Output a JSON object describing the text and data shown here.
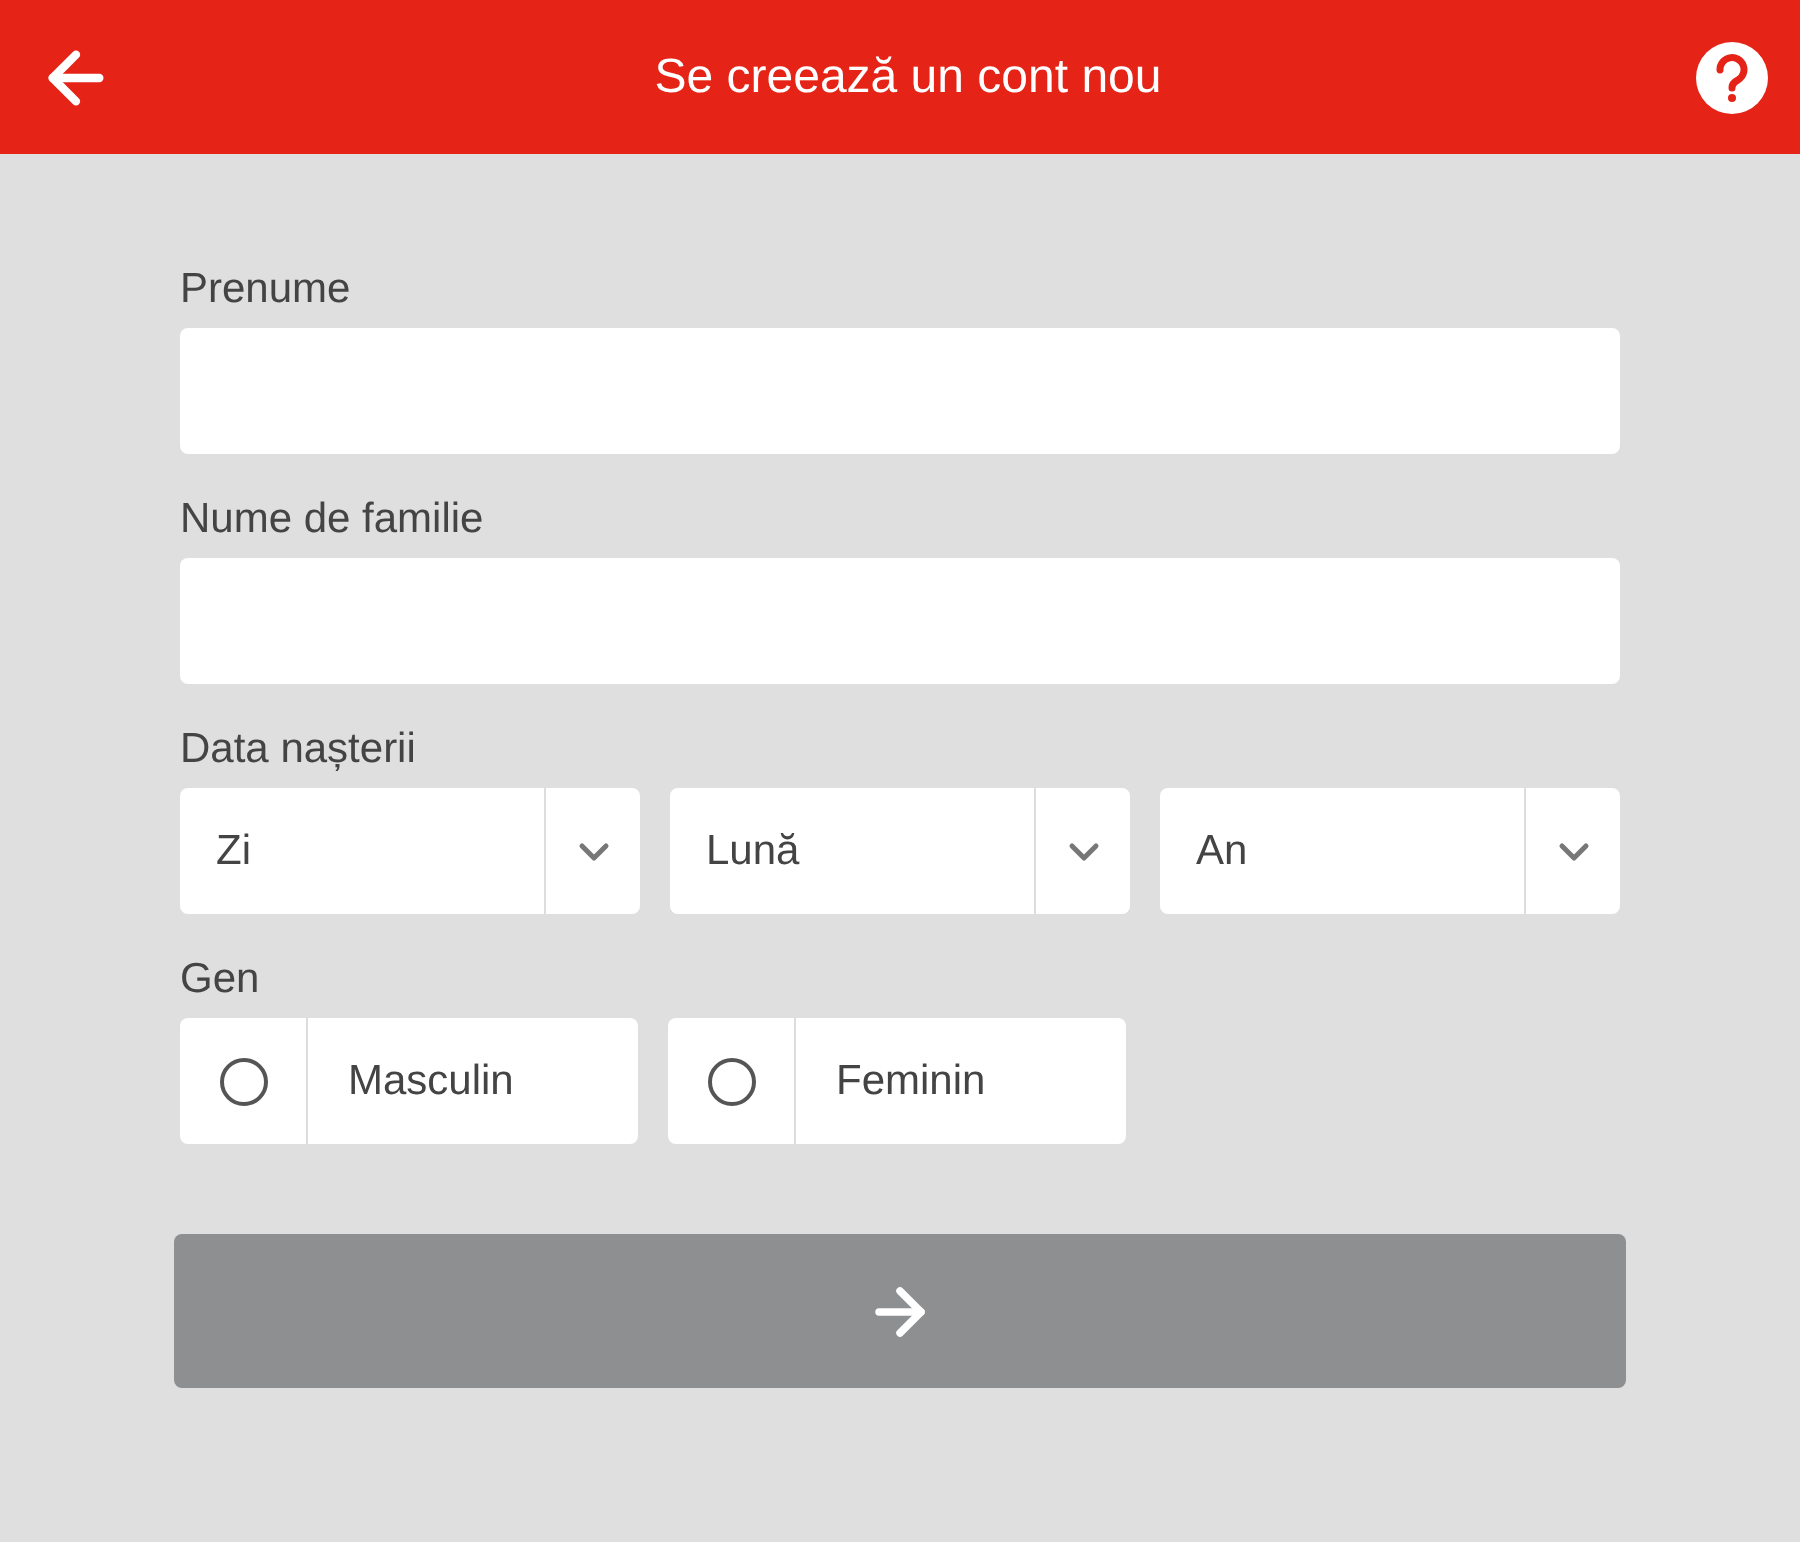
{
  "header": {
    "title": "Se creează un cont nou"
  },
  "fields": [
    {
      "label": "Prenume"
    },
    {
      "label": "Nume de familie"
    }
  ],
  "birth_date": {
    "label": "Data nașterii",
    "selects": [
      {
        "value": "Zi"
      },
      {
        "value": "Lună"
      },
      {
        "value": "An"
      }
    ]
  },
  "gender": {
    "label": "Gen",
    "options": [
      {
        "label": "Masculin",
        "selected": false
      },
      {
        "label": "Feminin",
        "selected": false
      }
    ]
  },
  "submit": {
    "disabled": true
  }
}
